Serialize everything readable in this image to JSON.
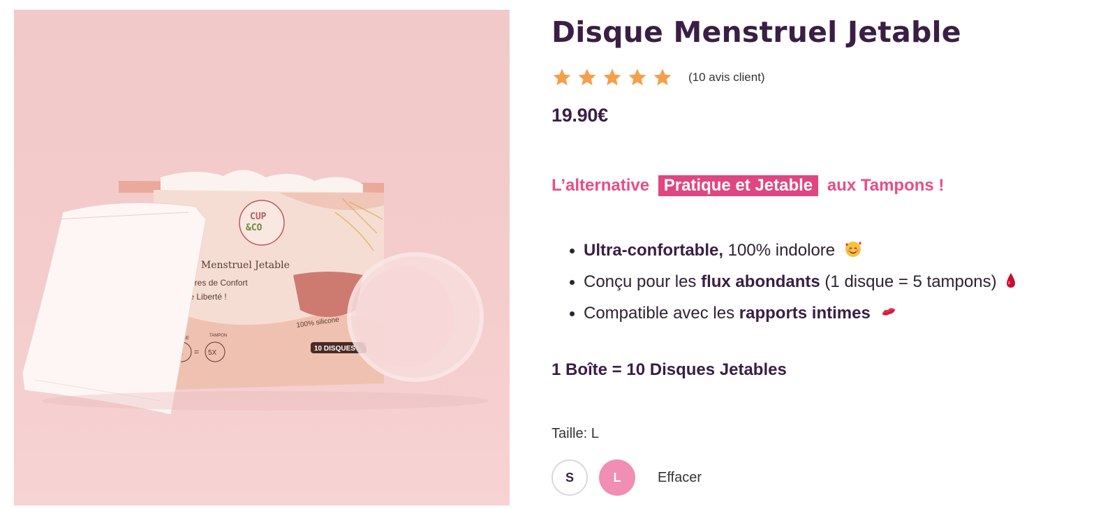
{
  "product": {
    "title": "Disque Menstruel Jetable",
    "rating_stars": 5,
    "reviews_text": "(10 avis client)",
    "price": "19.90€"
  },
  "image": {
    "box_brand": "CUP &CO",
    "box_brand_line1": "CUP",
    "box_brand_line2": "&CO",
    "box_title": "sque Menstruel Jetable",
    "box_line1": ", heures de Confort",
    "box_line2": "st de Liberté !",
    "box_silicone": "100% silicone",
    "box_disque_label": "DISQUE",
    "box_tampon_label": "TAMPON",
    "box_disque_count": "1X",
    "box_tampon_count": "5X",
    "box_badge": "10 DISQUES"
  },
  "tagline": {
    "before": "L’alternative",
    "highlight": "Pratique et Jetable",
    "after": "aux Tampons !"
  },
  "features": [
    {
      "bold": "Ultra-confortable,",
      "text": " 100% indolore",
      "emoji": "smiling-face-with-hearts-emoji"
    },
    {
      "pre": "Conçu pour les ",
      "bold": "flux abondants",
      "text": " (1 disque = 5 tampons)",
      "emoji": "drop-of-blood-emoji"
    },
    {
      "pre": "Compatible avec les ",
      "bold": "rapports intimes",
      "emoji": "kiss-mark-emoji"
    }
  ],
  "box_note": "1 Boîte = 10 Disques Jetables",
  "size": {
    "label": "Taille: L",
    "options": [
      "S",
      "L"
    ],
    "selected": "L",
    "clear": "Effacer"
  },
  "colors": {
    "accent_pink": "#e0467f",
    "selected_size": "#f08fb3",
    "star": "#f4a04a",
    "heading": "#3a1e44"
  }
}
